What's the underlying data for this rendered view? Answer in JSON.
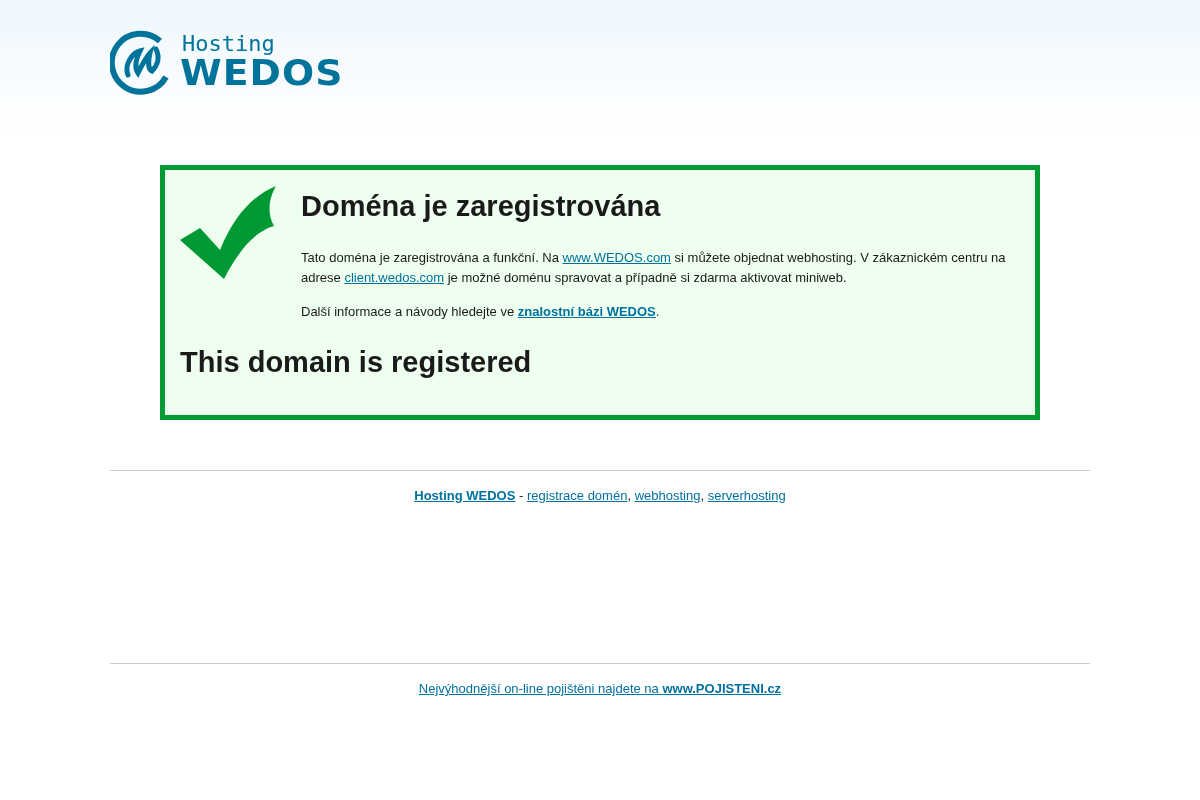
{
  "logo": {
    "top": "Hosting",
    "bottom": "WEDOS"
  },
  "notice": {
    "title": "Doména je zaregistrována",
    "paragraphs": [
      [
        {
          "kind": "text",
          "text": "Tato doména je zaregistrována a funkční. Na "
        },
        {
          "kind": "link",
          "text": "www.WEDOS.com",
          "bold": false
        },
        {
          "kind": "text",
          "text": " si můžete objednat webhosting. V zákaznickém centru na adrese "
        },
        {
          "kind": "link",
          "text": "client.wedos.com",
          "bold": false
        },
        {
          "kind": "text",
          "text": " je možné doménu spravovat a případně si zdarma aktivovat miniweb."
        }
      ],
      [
        {
          "kind": "text",
          "text": "Další informace a návody hledejte ve "
        },
        {
          "kind": "link",
          "text": "znalostní bázi WEDOS",
          "bold": true
        },
        {
          "kind": "text",
          "text": "."
        }
      ]
    ],
    "english_title": "This domain is registered"
  },
  "footer_links": [
    {
      "kind": "link",
      "text": "Hosting WEDOS",
      "bold": true
    },
    {
      "kind": "text",
      "text": " - "
    },
    {
      "kind": "link",
      "text": "registrace domén",
      "bold": false
    },
    {
      "kind": "text",
      "text": ", "
    },
    {
      "kind": "link",
      "text": "webhosting",
      "bold": false
    },
    {
      "kind": "text",
      "text": ", "
    },
    {
      "kind": "link",
      "text": "serverhosting",
      "bold": false
    }
  ],
  "bottom_link": "Nejvýhodnější on-line pojištěni najdete na **www.POJISTENI.cz**"
}
